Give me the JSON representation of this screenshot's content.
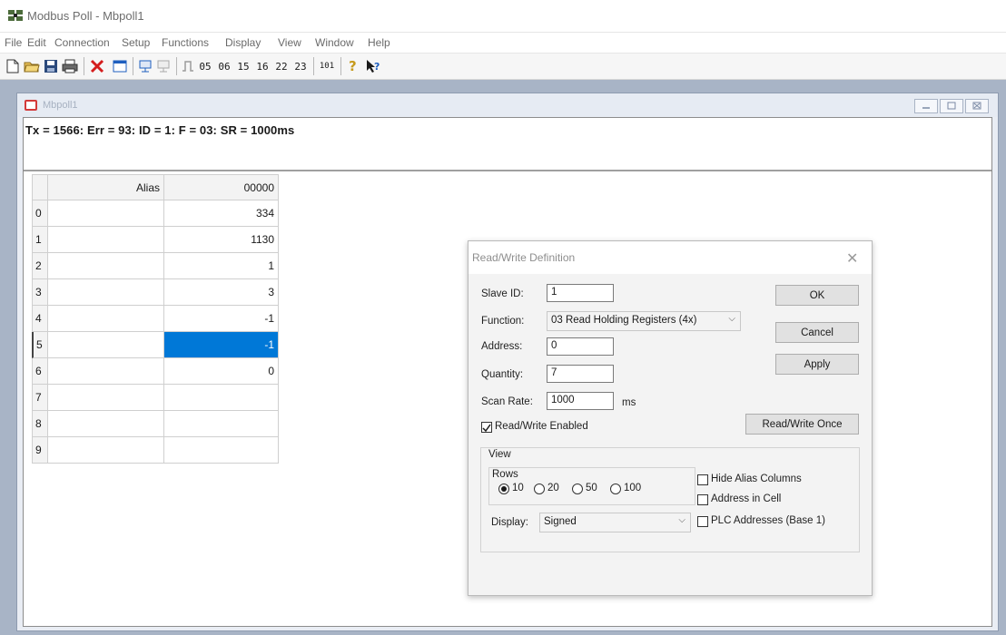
{
  "app": {
    "title": "Modbus Poll - Mbpoll1"
  },
  "menu": [
    "File",
    "Edit",
    "Connection",
    "Setup",
    "Functions",
    "Display",
    "View",
    "Window",
    "Help"
  ],
  "toolbar": {
    "codes": [
      "05",
      "06",
      "15",
      "16",
      "22",
      "23"
    ],
    "code_101": "101"
  },
  "child_window": {
    "title": "Mbpoll1",
    "status": "Tx = 1566: Err = 93: ID = 1: F = 03: SR = 1000ms"
  },
  "grid": {
    "header_alias": "Alias",
    "header_address": "00000",
    "row_numbers": [
      "0",
      "1",
      "2",
      "3",
      "4",
      "5",
      "6",
      "7",
      "8",
      "9"
    ],
    "values": [
      "334",
      "1130",
      "1",
      "3",
      "-1",
      "-1",
      "0",
      "",
      "",
      ""
    ],
    "selected_row": 5,
    "selected_color": "#0078d7"
  },
  "dialog": {
    "title": "Read/Write Definition",
    "close": "✕",
    "slave_id_label": "Slave ID:",
    "slave_id_value": "1",
    "function_label": "Function:",
    "function_value": "03 Read Holding Registers (4x)",
    "address_label": "Address:",
    "address_value": "0",
    "quantity_label": "Quantity:",
    "quantity_value": "7",
    "scan_rate_label": "Scan Rate:",
    "scan_rate_value": "1000",
    "scan_rate_unit": "ms",
    "rw_enabled_label": "Read/Write Enabled",
    "rw_enabled_checked": true,
    "ok": "OK",
    "cancel": "Cancel",
    "apply": "Apply",
    "rw_once": "Read/Write Once",
    "view_label": "View",
    "rows_label": "Rows",
    "rows_options": [
      "10",
      "20",
      "50",
      "100"
    ],
    "rows_selected": "10",
    "hide_alias_label": "Hide Alias Columns",
    "address_in_cell_label": "Address in Cell",
    "plc_addresses_label": "PLC Addresses (Base 1)",
    "display_label": "Display:",
    "display_value": "Signed"
  }
}
